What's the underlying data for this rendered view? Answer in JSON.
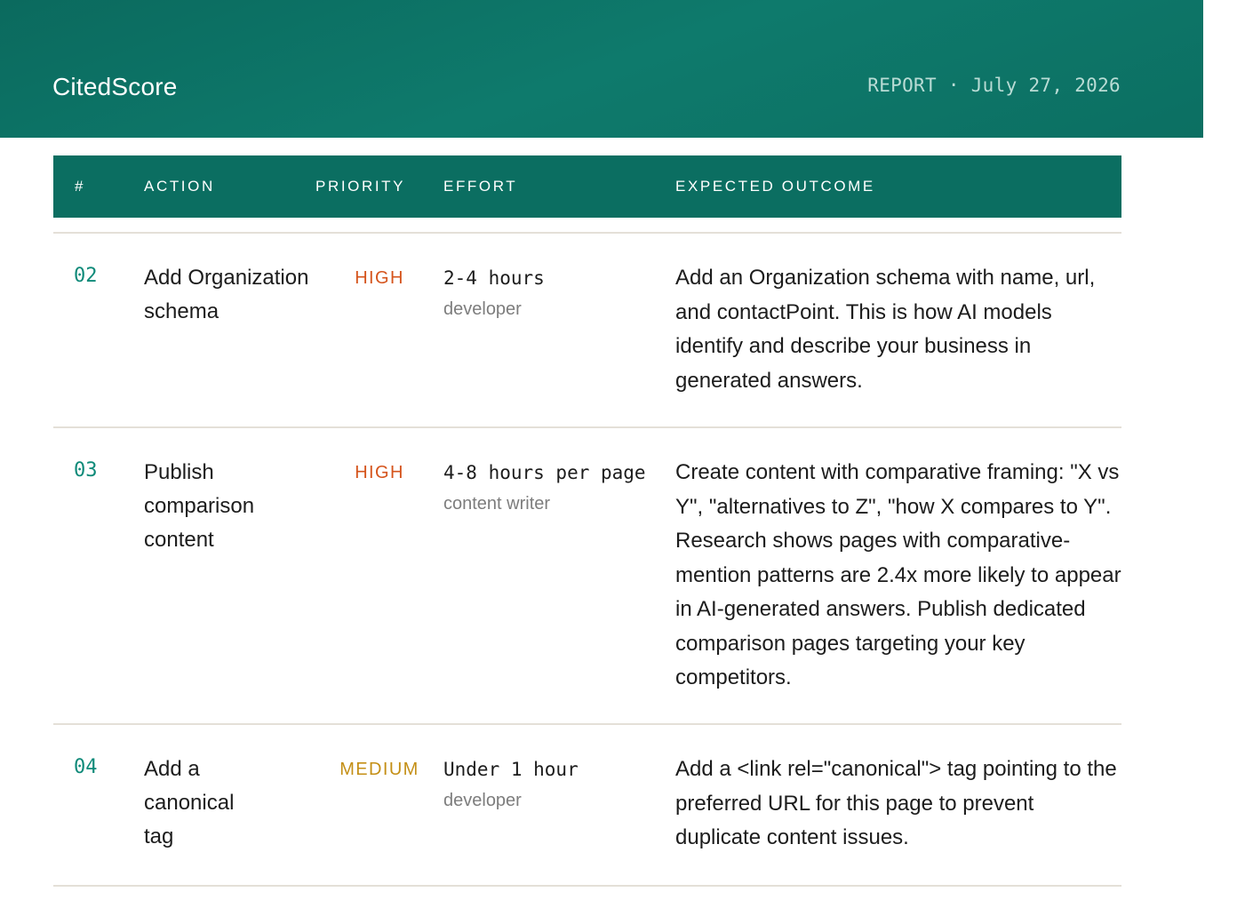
{
  "header": {
    "brand": "CitedScore",
    "meta": "REPORT · July 27, 2026"
  },
  "table": {
    "columns": [
      "#",
      "ACTION",
      "PRIORITY",
      "EFFORT",
      "EXPECTED OUTCOME"
    ],
    "rows": [
      {
        "num": "02",
        "action": "Add Organization schema",
        "priority": "HIGH",
        "effort_time": "2-4 hours",
        "effort_role": "developer",
        "outcome": "Add an Organization schema with name, url, and contactPoint. This is how AI models identify and describe your business in generated answers."
      },
      {
        "num": "03",
        "action": "Publish comparison content",
        "priority": "HIGH",
        "effort_time": "4-8 hours per page",
        "effort_role": "content writer",
        "outcome": "Create content with comparative framing: \"X vs Y\", \"alternatives to Z\", \"how X compares to Y\". Research shows pages with comparative-mention patterns are 2.4x more likely to appear in AI-generated answers. Publish dedicated comparison pages targeting your key competitors."
      },
      {
        "num": "04",
        "action": "Add a canonical tag",
        "priority": "MEDIUM",
        "effort_time": "Under 1 hour",
        "effort_role": "developer",
        "outcome": "Add a <link rel=\"canonical\"> tag pointing to the preferred URL for this page to prevent duplicate content issues."
      }
    ]
  },
  "colors": {
    "brand": "#0b6e61",
    "priority_high": "#d5541c",
    "priority_medium": "#c48f16",
    "row_number": "#0e8a79"
  }
}
